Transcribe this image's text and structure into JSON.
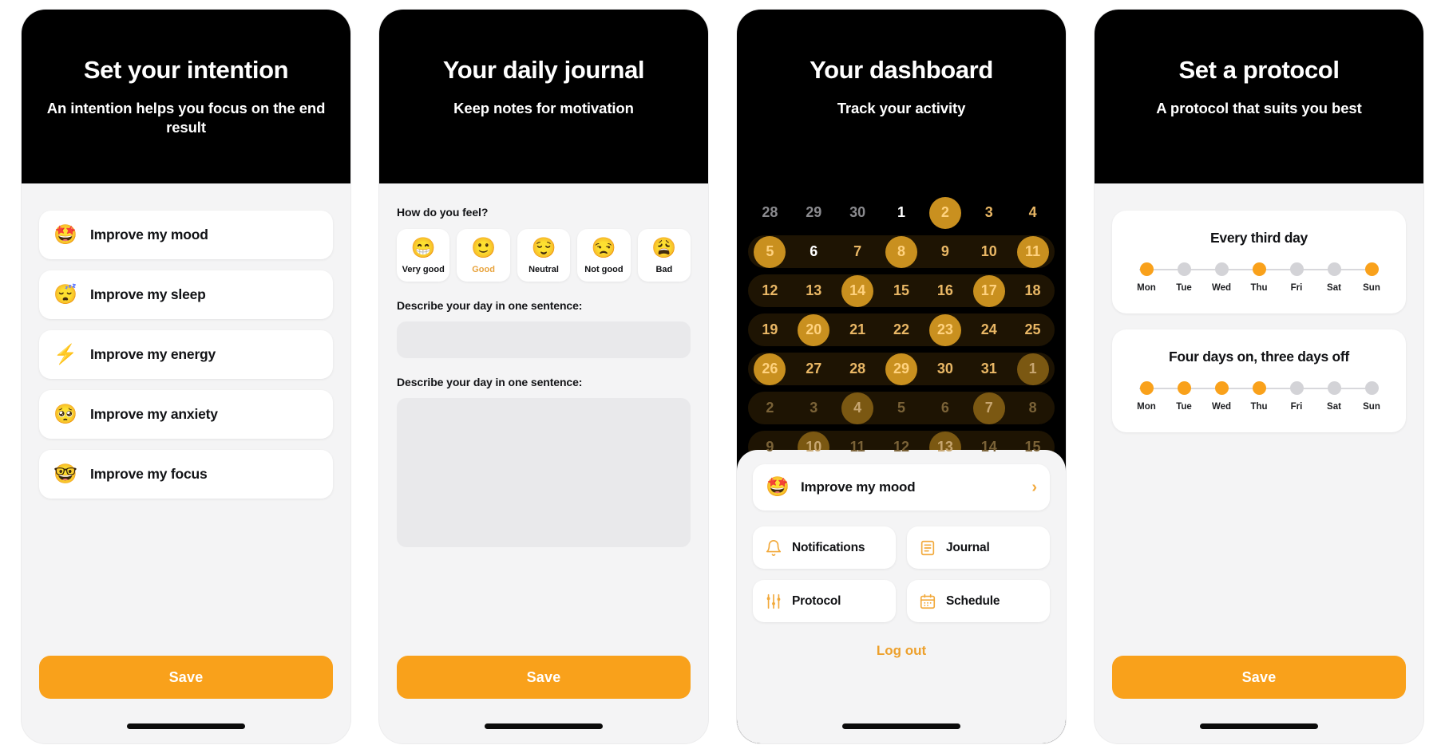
{
  "accent": "#f9a11b",
  "screens": {
    "intention": {
      "title": "Set your intention",
      "subtitle": "An intention helps you focus on the end result",
      "items": [
        {
          "emoji": "🤩",
          "label": "Improve my mood"
        },
        {
          "emoji": "😴",
          "label": "Improve my sleep"
        },
        {
          "emoji": "⚡",
          "label": "Improve my energy"
        },
        {
          "emoji": "🥺",
          "label": "Improve my anxiety"
        },
        {
          "emoji": "🤓",
          "label": "Improve my focus"
        }
      ],
      "save_label": "Save"
    },
    "journal": {
      "title": "Your daily journal",
      "subtitle": "Keep notes for motivation",
      "mood_question": "How do you feel?",
      "moods": [
        {
          "emoji": "😁",
          "label": "Very good",
          "selected": false
        },
        {
          "emoji": "🙂",
          "label": "Good",
          "selected": true
        },
        {
          "emoji": "😌",
          "label": "Neutral",
          "selected": false
        },
        {
          "emoji": "😒",
          "label": "Not good",
          "selected": false
        },
        {
          "emoji": "😩",
          "label": "Bad",
          "selected": false
        }
      ],
      "field_one_label": "Describe your day in one sentence:",
      "field_one_value": "",
      "field_one_placeholder": "",
      "field_two_label": "Describe your day in one sentence:",
      "field_two_value": "",
      "field_two_placeholder": "",
      "save_label": "Save"
    },
    "dashboard": {
      "title": "Your dashboard",
      "subtitle": "Track your activity",
      "calendar": {
        "rows": [
          {
            "band": false,
            "cells": [
              {
                "n": "28",
                "state": "muted"
              },
              {
                "n": "29",
                "state": "muted"
              },
              {
                "n": "30",
                "state": "muted"
              },
              {
                "n": "1",
                "state": "white"
              },
              {
                "n": "2",
                "state": "active"
              },
              {
                "n": "3",
                "state": "normal"
              },
              {
                "n": "4",
                "state": "normal"
              }
            ]
          },
          {
            "band": true,
            "cells": [
              {
                "n": "5",
                "state": "active"
              },
              {
                "n": "6",
                "state": "white"
              },
              {
                "n": "7",
                "state": "normal"
              },
              {
                "n": "8",
                "state": "active"
              },
              {
                "n": "9",
                "state": "normal"
              },
              {
                "n": "10",
                "state": "normal"
              },
              {
                "n": "11",
                "state": "active"
              }
            ]
          },
          {
            "band": true,
            "cells": [
              {
                "n": "12",
                "state": "normal"
              },
              {
                "n": "13",
                "state": "normal"
              },
              {
                "n": "14",
                "state": "active"
              },
              {
                "n": "15",
                "state": "normal"
              },
              {
                "n": "16",
                "state": "normal"
              },
              {
                "n": "17",
                "state": "active"
              },
              {
                "n": "18",
                "state": "normal"
              }
            ]
          },
          {
            "band": true,
            "cells": [
              {
                "n": "19",
                "state": "normal"
              },
              {
                "n": "20",
                "state": "active"
              },
              {
                "n": "21",
                "state": "normal"
              },
              {
                "n": "22",
                "state": "normal"
              },
              {
                "n": "23",
                "state": "active"
              },
              {
                "n": "24",
                "state": "normal"
              },
              {
                "n": "25",
                "state": "normal"
              }
            ]
          },
          {
            "band": true,
            "cells": [
              {
                "n": "26",
                "state": "active"
              },
              {
                "n": "27",
                "state": "normal"
              },
              {
                "n": "28",
                "state": "normal"
              },
              {
                "n": "29",
                "state": "active"
              },
              {
                "n": "30",
                "state": "normal"
              },
              {
                "n": "31",
                "state": "normal"
              },
              {
                "n": "1",
                "state": "active-faded"
              }
            ]
          },
          {
            "band": true,
            "cells": [
              {
                "n": "2",
                "state": "dim"
              },
              {
                "n": "3",
                "state": "dim"
              },
              {
                "n": "4",
                "state": "active-faded"
              },
              {
                "n": "5",
                "state": "dim"
              },
              {
                "n": "6",
                "state": "dim"
              },
              {
                "n": "7",
                "state": "active-faded"
              },
              {
                "n": "8",
                "state": "dim"
              }
            ]
          },
          {
            "band": true,
            "cells": [
              {
                "n": "9",
                "state": "dim"
              },
              {
                "n": "10",
                "state": "active-faded"
              },
              {
                "n": "11",
                "state": "dim"
              },
              {
                "n": "12",
                "state": "dim"
              },
              {
                "n": "13",
                "state": "active-faded"
              },
              {
                "n": "14",
                "state": "dim"
              },
              {
                "n": "15",
                "state": "dim"
              }
            ]
          }
        ]
      },
      "sheet": {
        "current_intention_emoji": "🤩",
        "current_intention": "Improve my mood",
        "chevron": "›",
        "tiles": [
          {
            "icon": "bell-icon",
            "label": "Notifications"
          },
          {
            "icon": "journal-icon",
            "label": "Journal"
          },
          {
            "icon": "sliders-icon",
            "label": "Protocol"
          },
          {
            "icon": "calendar-icon",
            "label": "Schedule"
          }
        ],
        "logout_label": "Log out"
      }
    },
    "protocol": {
      "title": "Set a protocol",
      "subtitle": "A protocol that suits you best",
      "options": [
        {
          "title": "Every third day",
          "days": [
            {
              "label": "Mon",
              "on": true
            },
            {
              "label": "Tue",
              "on": false
            },
            {
              "label": "Wed",
              "on": false
            },
            {
              "label": "Thu",
              "on": true
            },
            {
              "label": "Fri",
              "on": false
            },
            {
              "label": "Sat",
              "on": false
            },
            {
              "label": "Sun",
              "on": true
            }
          ]
        },
        {
          "title": "Four days on, three days off",
          "days": [
            {
              "label": "Mon",
              "on": true
            },
            {
              "label": "Tue",
              "on": true
            },
            {
              "label": "Wed",
              "on": true
            },
            {
              "label": "Thu",
              "on": true
            },
            {
              "label": "Fri",
              "on": false
            },
            {
              "label": "Sat",
              "on": false
            },
            {
              "label": "Sun",
              "on": false
            }
          ]
        }
      ],
      "save_label": "Save"
    }
  }
}
